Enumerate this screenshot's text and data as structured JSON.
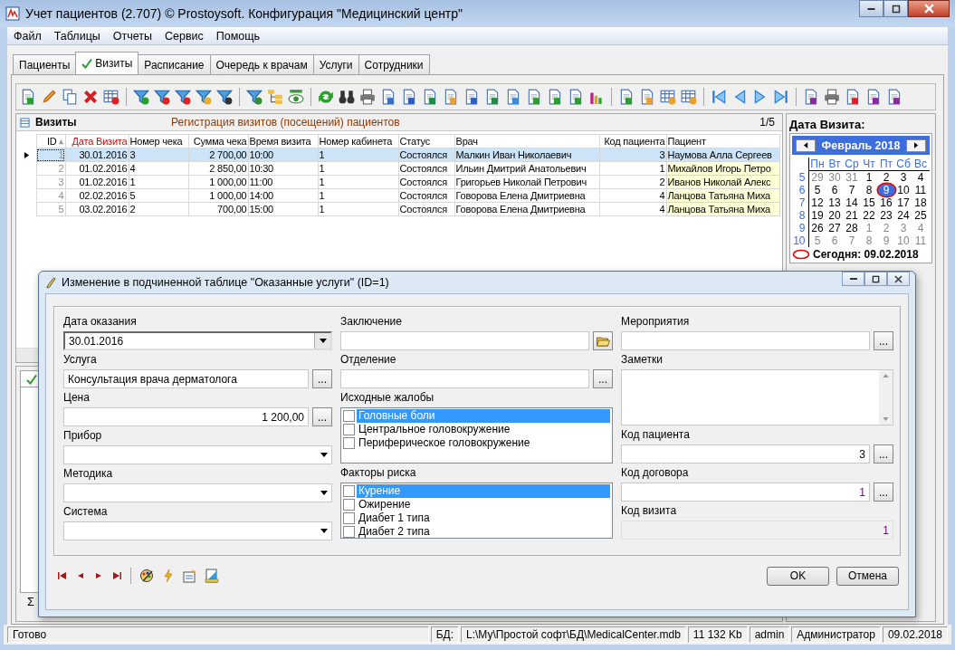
{
  "window": {
    "title": "Учет пациентов (2.707) © Prostoysoft. Конфигурация \"Медицинский центр\""
  },
  "menu": [
    "Файл",
    "Таблицы",
    "Отчеты",
    "Сервис",
    "Помощь"
  ],
  "tabs": [
    {
      "label": "Пациенты",
      "selected": false
    },
    {
      "label": "Визиты",
      "selected": true
    },
    {
      "label": "Расписание",
      "selected": false
    },
    {
      "label": "Очередь к врачам",
      "selected": false
    },
    {
      "label": "Услуги",
      "selected": false
    },
    {
      "label": "Сотрудники",
      "selected": false
    }
  ],
  "visits": {
    "title": "Визиты",
    "subtitle": "Регистрация визитов (посещений) пациентов",
    "counter": "1/5",
    "columns": [
      {
        "label": "ID",
        "kind": "id",
        "sorted": true
      },
      {
        "label": "Дата Визита",
        "kind": "key",
        "sorted": false
      },
      {
        "label": "Номер чека",
        "kind": "plain",
        "sorted": false
      },
      {
        "label": "Сумма чека",
        "kind": "money",
        "sorted": false
      },
      {
        "label": "Время визита",
        "kind": "plain",
        "sorted": false
      },
      {
        "label": "Номер кабинета",
        "kind": "plain",
        "sorted": false
      },
      {
        "label": "Статус",
        "kind": "plain",
        "sorted": false
      },
      {
        "label": "Врач",
        "kind": "plain",
        "sorted": false
      },
      {
        "label": "Код пациента",
        "kind": "money",
        "sorted": false
      },
      {
        "label": "Пациент",
        "kind": "lookup",
        "sorted": false
      }
    ],
    "rows": [
      {
        "selected": true,
        "cells": [
          "1",
          "30.01.2016",
          "3",
          "2 700,00",
          "10:00",
          "1",
          "Состоялся",
          "Малкин Иван Николаевич",
          "3",
          "Наумова Алла Сергеев"
        ]
      },
      {
        "selected": false,
        "cells": [
          "2",
          "01.02.2016",
          "4",
          "2 850,00",
          "10:30",
          "1",
          "Состоялся",
          "Ильин Дмитрий Анатольевич",
          "1",
          "Михайлов Игорь Петро"
        ]
      },
      {
        "selected": false,
        "cells": [
          "3",
          "01.02.2016",
          "1",
          "1 000,00",
          "11:00",
          "1",
          "Состоялся",
          "Григорьев Николай Петрович",
          "2",
          "Иванов Николай Алекс"
        ]
      },
      {
        "selected": false,
        "cells": [
          "4",
          "02.02.2016",
          "5",
          "1 000,00",
          "14:00",
          "1",
          "Состоялся",
          "Говорова Елена Дмитриевна",
          "4",
          "Ланцова Татьяна Миха"
        ]
      },
      {
        "selected": false,
        "cells": [
          "5",
          "03.02.2016",
          "2",
          "700,00",
          "15:00",
          "1",
          "Состоялся",
          "Говорова Елена Дмитриевна",
          "4",
          "Ланцова Татьяна Миха"
        ]
      }
    ]
  },
  "calendar": {
    "label": "Дата Визита:",
    "month": "Февраль 2018",
    "weekdays": [
      "Пн",
      "Вт",
      "Ср",
      "Чт",
      "Пт",
      "Сб",
      "Вс"
    ],
    "weeks": [
      {
        "number": "5",
        "days": [
          {
            "day": "29",
            "muted": true,
            "selected": false
          },
          {
            "day": "30",
            "muted": true,
            "selected": false
          },
          {
            "day": "31",
            "muted": true,
            "selected": false
          },
          {
            "day": "1",
            "muted": false,
            "selected": false
          },
          {
            "day": "2",
            "muted": false,
            "selected": false
          },
          {
            "day": "3",
            "muted": false,
            "selected": false
          },
          {
            "day": "4",
            "muted": false,
            "selected": false
          }
        ]
      },
      {
        "number": "6",
        "days": [
          {
            "day": "5",
            "muted": false,
            "selected": false
          },
          {
            "day": "6",
            "muted": false,
            "selected": false
          },
          {
            "day": "7",
            "muted": false,
            "selected": false
          },
          {
            "day": "8",
            "muted": false,
            "selected": false
          },
          {
            "day": "9",
            "muted": false,
            "selected": true
          },
          {
            "day": "10",
            "muted": false,
            "selected": false
          },
          {
            "day": "11",
            "muted": false,
            "selected": false
          }
        ]
      },
      {
        "number": "7",
        "days": [
          {
            "day": "12",
            "muted": false,
            "selected": false
          },
          {
            "day": "13",
            "muted": false,
            "selected": false
          },
          {
            "day": "14",
            "muted": false,
            "selected": false
          },
          {
            "day": "15",
            "muted": false,
            "selected": false
          },
          {
            "day": "16",
            "muted": false,
            "selected": false
          },
          {
            "day": "17",
            "muted": false,
            "selected": false
          },
          {
            "day": "18",
            "muted": false,
            "selected": false
          }
        ]
      },
      {
        "number": "8",
        "days": [
          {
            "day": "19",
            "muted": false,
            "selected": false
          },
          {
            "day": "20",
            "muted": false,
            "selected": false
          },
          {
            "day": "21",
            "muted": false,
            "selected": false
          },
          {
            "day": "22",
            "muted": false,
            "selected": false
          },
          {
            "day": "23",
            "muted": false,
            "selected": false
          },
          {
            "day": "24",
            "muted": false,
            "selected": false
          },
          {
            "day": "25",
            "muted": false,
            "selected": false
          }
        ]
      },
      {
        "number": "9",
        "days": [
          {
            "day": "26",
            "muted": false,
            "selected": false
          },
          {
            "day": "27",
            "muted": false,
            "selected": false
          },
          {
            "day": "28",
            "muted": false,
            "selected": false
          },
          {
            "day": "1",
            "muted": true,
            "selected": false
          },
          {
            "day": "2",
            "muted": true,
            "selected": false
          },
          {
            "day": "3",
            "muted": true,
            "selected": false
          },
          {
            "day": "4",
            "muted": true,
            "selected": false
          }
        ]
      },
      {
        "number": "10",
        "days": [
          {
            "day": "5",
            "muted": true,
            "selected": false
          },
          {
            "day": "6",
            "muted": true,
            "selected": false
          },
          {
            "day": "7",
            "muted": true,
            "selected": false
          },
          {
            "day": "8",
            "muted": true,
            "selected": false
          },
          {
            "day": "9",
            "muted": true,
            "selected": false
          },
          {
            "day": "10",
            "muted": true,
            "selected": false
          },
          {
            "day": "11",
            "muted": true,
            "selected": false
          }
        ]
      }
    ],
    "today": "Сегодня: 09.02.2018"
  },
  "lower_panel": {
    "footer_symbol": "Σ"
  },
  "dialog": {
    "title": "Изменение в подчиненной таблице \"Оказанные услуги\" (ID=1)",
    "columns": [
      [
        {
          "label": "Дата оказания",
          "kind": "combo",
          "value": "30.01.2016"
        },
        {
          "label": "Услуга",
          "kind": "text",
          "value": "Консультация врача дерматолога",
          "button": "..."
        },
        {
          "label": "Цена",
          "kind": "number",
          "value": "1 200,00",
          "button": "..."
        },
        {
          "label": "Прибор",
          "kind": "combo"
        },
        {
          "label": "Методика",
          "kind": "combo"
        },
        {
          "label": "Система",
          "kind": "combo"
        }
      ],
      [
        {
          "label": "Заключение",
          "kind": "file"
        },
        {
          "label": "Отделение",
          "kind": "text",
          "button": "..."
        },
        {
          "label": "Исходные жалобы",
          "kind": "checklist",
          "items": [
            {
              "label": "Головные боли",
              "checked": false,
              "selected": true
            },
            {
              "label": "Центральное головокружение",
              "checked": false,
              "selected": false
            },
            {
              "label": "Периферическое головокружение",
              "checked": false,
              "selected": false
            }
          ]
        },
        {
          "label": "Факторы риска",
          "kind": "checklist",
          "items": [
            {
              "label": "Курение",
              "checked": false,
              "selected": true
            },
            {
              "label": "Ожирение",
              "checked": false,
              "selected": false
            },
            {
              "label": "Диабет 1 типа",
              "checked": false,
              "selected": false
            },
            {
              "label": "Диабет 2 типа",
              "checked": false,
              "selected": false
            }
          ]
        }
      ],
      [
        {
          "label": "Мероприятия",
          "kind": "text",
          "button": "..."
        },
        {
          "label": "Заметки",
          "kind": "memo"
        },
        {
          "label": "Код пациента",
          "kind": "number",
          "value": "3",
          "button": "..."
        },
        {
          "label": "Код договора",
          "kind": "reference",
          "value": "1",
          "button": "..."
        },
        {
          "label": "Код визита",
          "kind": "readonly",
          "value": "1"
        }
      ]
    ],
    "buttons": [
      "OK",
      "Отмена"
    ]
  },
  "status_bar": [
    "Готово",
    "БД:",
    "L:\\Му\\Простой софт\\БД\\MedicalCenter.mdb",
    "11 132 Kb",
    "admin",
    "Администратор",
    "09.02.2018"
  ]
}
